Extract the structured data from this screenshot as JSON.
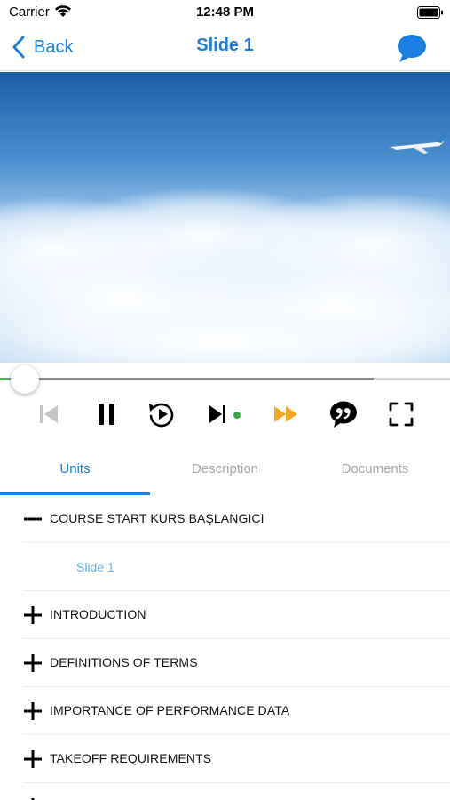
{
  "status_bar": {
    "carrier": "Carrier",
    "time": "12:48 PM"
  },
  "nav": {
    "back_label": "Back",
    "title": "Slide 1"
  },
  "player": {
    "progress_fraction": 0.02,
    "buffered_fraction": 0.83,
    "controls": [
      "skip-previous-icon",
      "pause-icon",
      "replay-icon",
      "skip-next-icon",
      "fast-forward-icon",
      "subtitles-icon",
      "fullscreen-icon"
    ]
  },
  "tabs": [
    {
      "label": "Units",
      "active": true
    },
    {
      "label": "Description",
      "active": false
    },
    {
      "label": "Documents",
      "active": false
    }
  ],
  "units": [
    {
      "title": "COURSE START KURS BAŞLANGICI",
      "expanded": true,
      "lessons": [
        "Slide 1"
      ]
    },
    {
      "title": "INTRODUCTION",
      "expanded": false
    },
    {
      "title": "DEFINITIONS OF TERMS",
      "expanded": false
    },
    {
      "title": "IMPORTANCE OF PERFORMANCE DATA",
      "expanded": false
    },
    {
      "title": "TAKEOFF REQUIREMENTS",
      "expanded": false
    }
  ],
  "colors": {
    "accent": "#1a7ee0",
    "fast_forward": "#f5a623",
    "indicator_dot": "#2ea84a",
    "lesson_link": "#5ab4e6",
    "disabled_control": "#c4c4c4"
  }
}
